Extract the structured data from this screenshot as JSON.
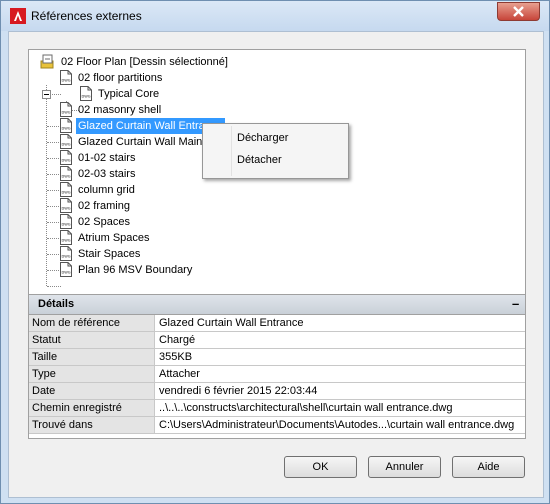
{
  "window": {
    "title": "Références externes",
    "close_symbol": "×"
  },
  "tree": {
    "root": {
      "label": "02 Floor Plan [Dessin sélectionné]",
      "icon": "drawing-root-icon"
    },
    "children": [
      {
        "label": "02 floor partitions",
        "icon": "dwg-file-icon",
        "expanded": true
      },
      {
        "label": "Typical Core",
        "icon": "dwg-file-icon"
      },
      {
        "label": "02 masonry shell",
        "icon": "dwg-file-icon"
      },
      {
        "label": "Glazed Curtain Wall Entrance",
        "icon": "dwg-file-icon",
        "selected": true
      },
      {
        "label": "Glazed Curtain Wall Main",
        "icon": "dwg-file-icon"
      },
      {
        "label": "01-02 stairs",
        "icon": "dwg-file-icon"
      },
      {
        "label": "02-03 stairs",
        "icon": "dwg-file-icon"
      },
      {
        "label": "column grid",
        "icon": "dwg-file-icon"
      },
      {
        "label": "02 framing",
        "icon": "dwg-file-icon"
      },
      {
        "label": "02 Spaces",
        "icon": "dwg-file-icon"
      },
      {
        "label": "Atrium Spaces",
        "icon": "dwg-file-icon"
      },
      {
        "label": "Stair Spaces",
        "icon": "dwg-file-icon"
      },
      {
        "label": "Plan 96 MSV Boundary",
        "icon": "dwg-file-icon"
      }
    ]
  },
  "context_menu": {
    "items": [
      "Décharger",
      "Détacher"
    ]
  },
  "details": {
    "title": "Détails",
    "collapse_symbol": "–",
    "rows": [
      {
        "key": "Nom de référence",
        "value": "Glazed Curtain Wall Entrance"
      },
      {
        "key": "Statut",
        "value": "Chargé"
      },
      {
        "key": "Taille",
        "value": "355KB"
      },
      {
        "key": "Type",
        "value": "Attacher"
      },
      {
        "key": "Date",
        "value": "vendredi 6 février 2015  22:03:44"
      },
      {
        "key": "Chemin enregistré",
        "value": "..\\..\\..\\constructs\\architectural\\shell\\curtain wall entrance.dwg"
      },
      {
        "key": "Trouvé dans",
        "value": "C:\\Users\\Administrateur\\Documents\\Autodes...\\curtain wall entrance.dwg"
      }
    ]
  },
  "buttons": {
    "ok": "OK",
    "cancel": "Annuler",
    "help": "Aide"
  },
  "colors": {
    "selection": "#3399ff",
    "close_button": "#c7453a",
    "app_icon": "#d71920"
  }
}
